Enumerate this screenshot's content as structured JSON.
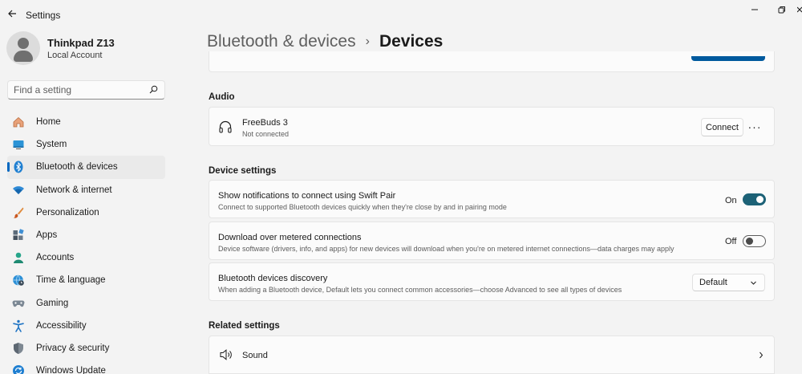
{
  "window": {
    "title": "Settings",
    "controls": {
      "minimize": "—",
      "maximize": "restore",
      "close": "close"
    }
  },
  "profile": {
    "name": "Thinkpad Z13",
    "account": "Local Account"
  },
  "search": {
    "placeholder": "Find a setting",
    "value": ""
  },
  "sidebar": {
    "items": [
      {
        "label": "Home",
        "icon": "home-icon"
      },
      {
        "label": "System",
        "icon": "system-icon"
      },
      {
        "label": "Bluetooth & devices",
        "icon": "bluetooth-icon",
        "active": true
      },
      {
        "label": "Network & internet",
        "icon": "wifi-icon"
      },
      {
        "label": "Personalization",
        "icon": "brush-icon"
      },
      {
        "label": "Apps",
        "icon": "apps-icon"
      },
      {
        "label": "Accounts",
        "icon": "accounts-icon"
      },
      {
        "label": "Time & language",
        "icon": "globe-clock-icon"
      },
      {
        "label": "Gaming",
        "icon": "gamepad-icon"
      },
      {
        "label": "Accessibility",
        "icon": "accessibility-icon"
      },
      {
        "label": "Privacy & security",
        "icon": "shield-icon"
      },
      {
        "label": "Windows Update",
        "icon": "update-icon"
      }
    ]
  },
  "breadcrumb": {
    "parent": "Bluetooth & devices",
    "separator": "›",
    "current": "Devices"
  },
  "audio": {
    "section_title": "Audio",
    "device": {
      "name": "FreeBuds 3",
      "status": "Not connected",
      "connect_label": "Connect",
      "more_label": "···"
    }
  },
  "device_settings": {
    "section_title": "Device settings",
    "swift_pair": {
      "title": "Show notifications to connect using Swift Pair",
      "description": "Connect to supported Bluetooth devices quickly when they're close by and in pairing mode",
      "state_label": "On",
      "on": true
    },
    "metered": {
      "title": "Download over metered connections",
      "description": "Device software (drivers, info, and apps) for new devices will download when you're on metered internet connections—data charges may apply",
      "state_label": "Off",
      "on": false
    },
    "discovery": {
      "title": "Bluetooth devices discovery",
      "description": "When adding a Bluetooth device, Default lets you connect common accessories—choose Advanced to see all types of devices",
      "selected": "Default"
    }
  },
  "related": {
    "section_title": "Related settings",
    "sound_label": "Sound"
  },
  "colors": {
    "accent": "#1d6277",
    "nav_indicator": "#0067c0",
    "background": "#f3f3f3",
    "card": "#fbfbfb"
  }
}
